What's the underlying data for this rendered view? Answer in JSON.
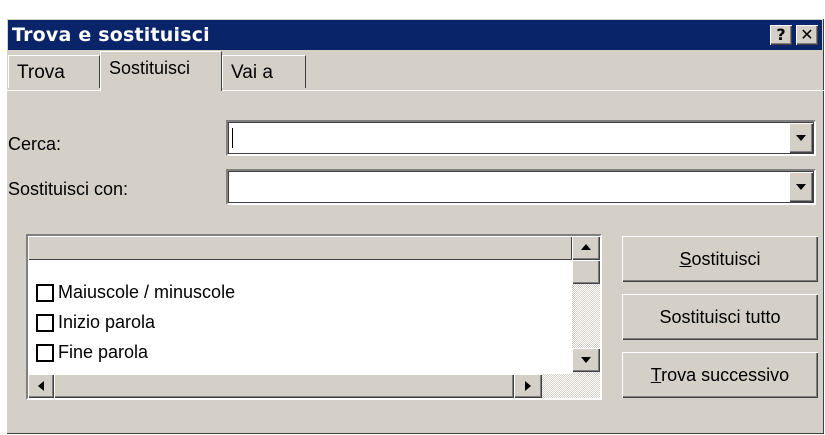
{
  "window": {
    "title": "Trova e sostituisci",
    "help_glyph": "?",
    "close_glyph": "✕"
  },
  "tabs": [
    {
      "label": "Trova",
      "active": false
    },
    {
      "label": "Sostituisci",
      "active": true
    },
    {
      "label": "Vai a",
      "active": false
    }
  ],
  "fields": {
    "find_label": "Cerca:",
    "find_value": "",
    "replace_label": "Sostituisci con:",
    "replace_value": ""
  },
  "options": [
    {
      "label": "Maiuscole / minuscole",
      "checked": false
    },
    {
      "label": "Inizio parola",
      "checked": false
    },
    {
      "label": "Fine parola",
      "checked": false
    }
  ],
  "buttons": {
    "replace": {
      "mnemonic": "S",
      "rest": "ostituisci"
    },
    "replace_all": "Sostituisci tutto",
    "find_next": {
      "mnemonic": "T",
      "rest": "rova successivo"
    }
  },
  "colors": {
    "titlebar": "#0a246a",
    "face": "#d4d0c8"
  }
}
